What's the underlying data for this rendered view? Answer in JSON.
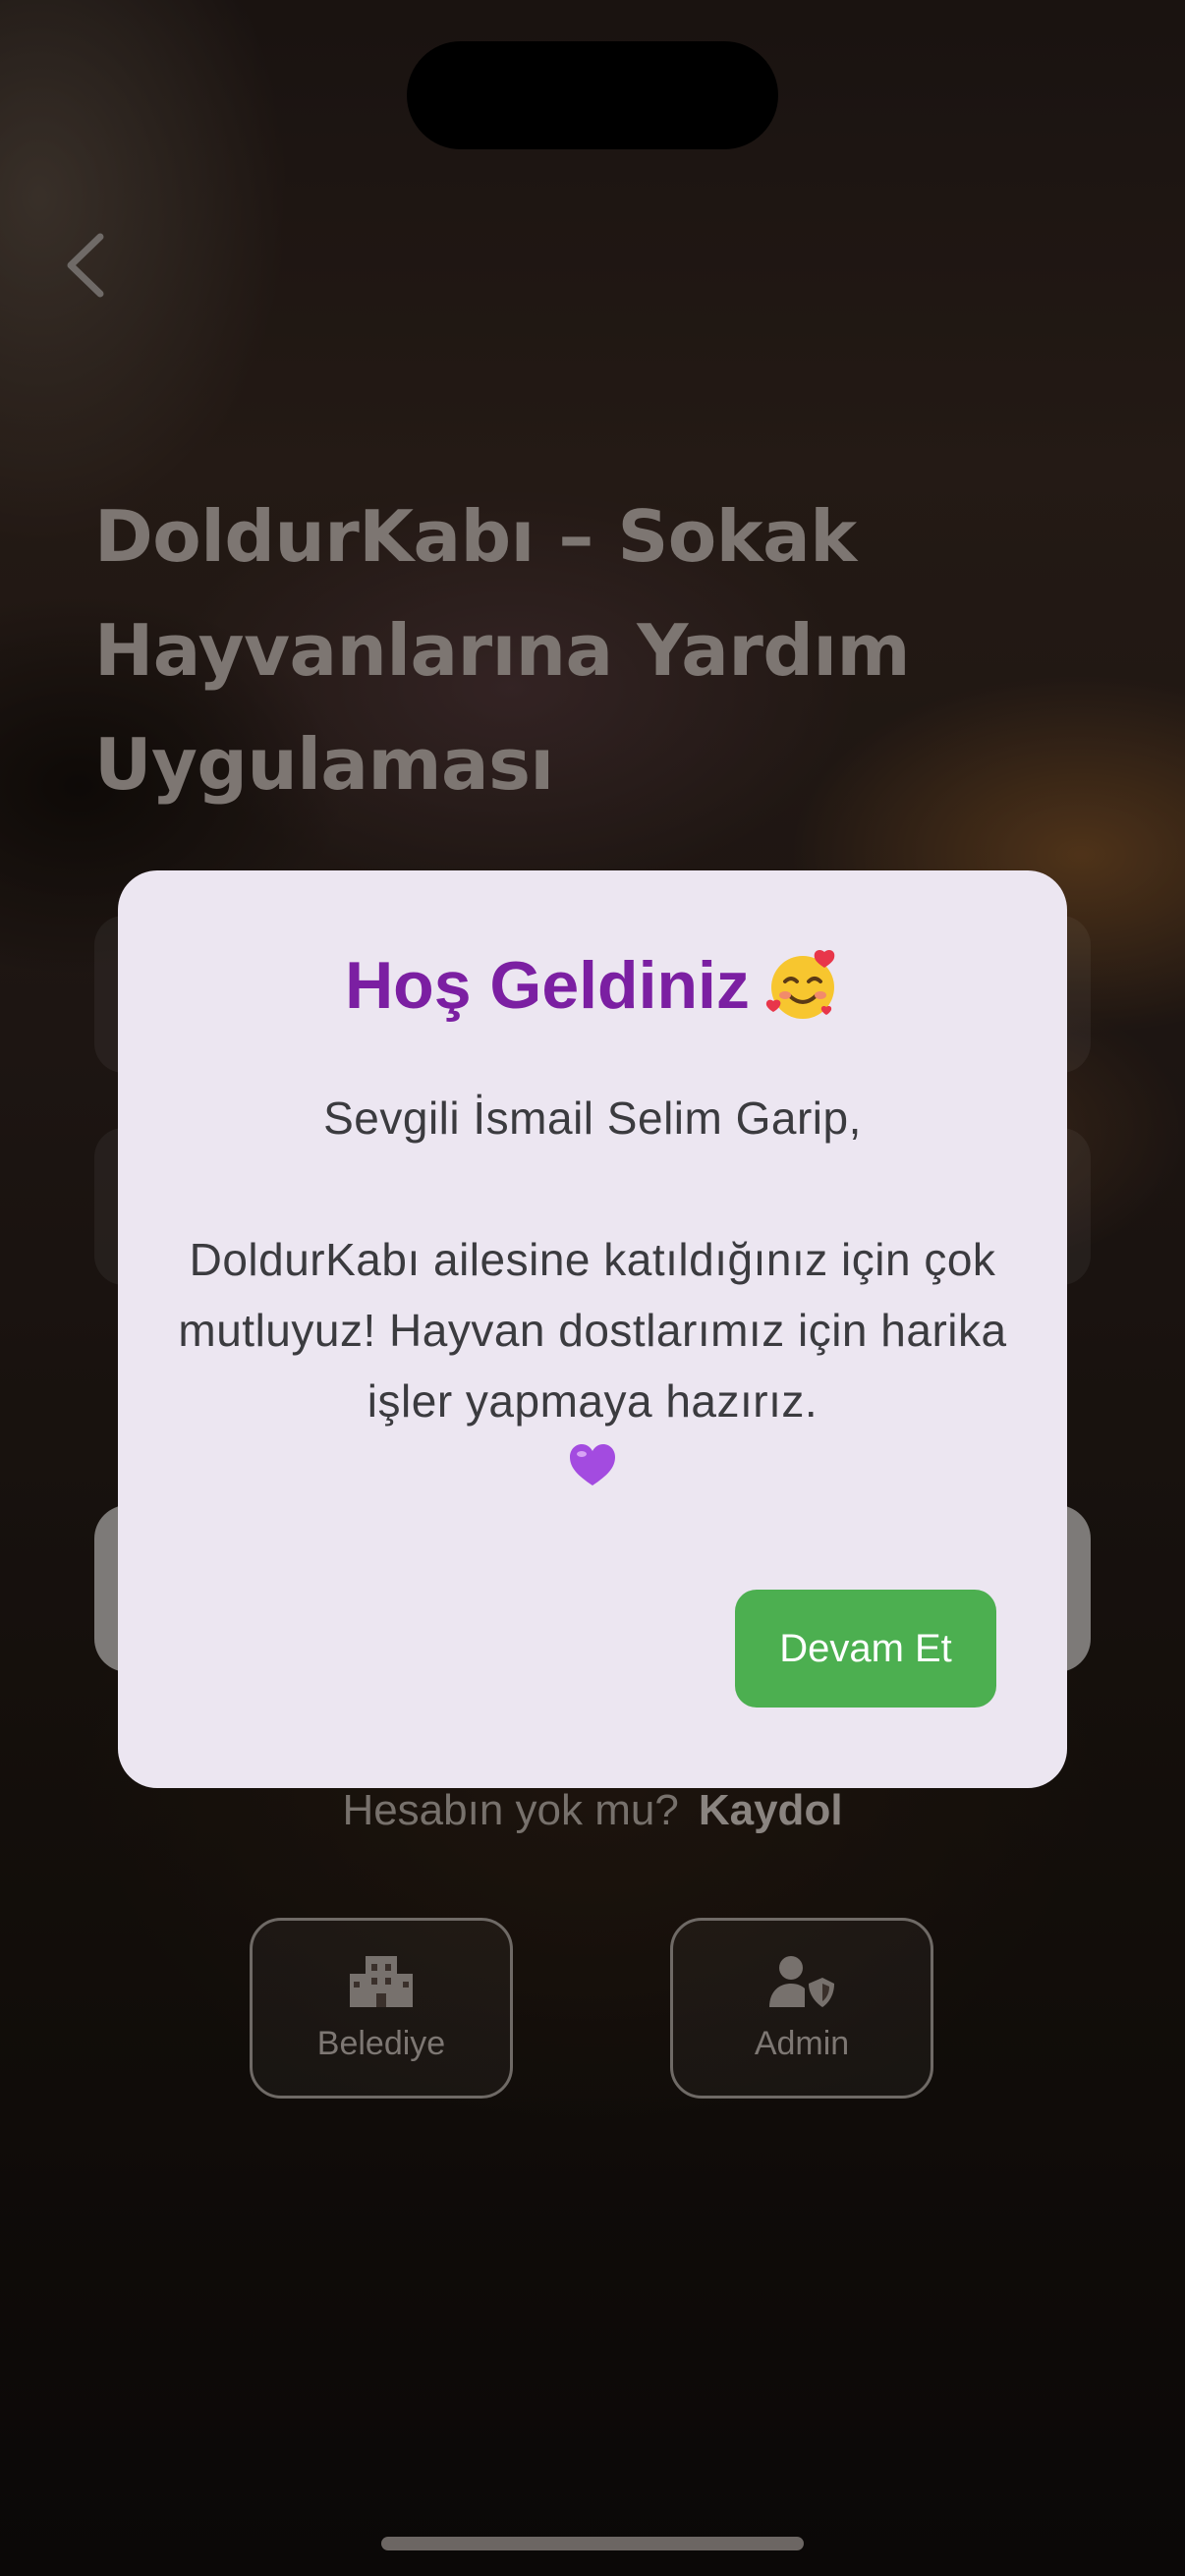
{
  "background": {
    "title": "DoldurKabı – Sokak Hayvanlarına Yardım Uygulaması",
    "signup_prompt": "Hesabın yok mu?",
    "signup_link": "Kaydol",
    "roles": [
      {
        "label": "Belediye",
        "icon": "building-icon"
      },
      {
        "label": "Admin",
        "icon": "user-shield-icon"
      }
    ]
  },
  "dialog": {
    "title": "Hoş Geldiniz",
    "title_emoji": "smiling-face-with-hearts",
    "greeting": "Sevgili İsmail Selim Garip,",
    "message": "DoldurKabı ailesine katıldığınız için çok mutluyuz! Hayvan dostlarımız için harika işler yapmaya hazırız.",
    "message_emoji": "purple-heart",
    "button_label": "Devam Et"
  },
  "colors": {
    "dialog_title": "#7b1fa2",
    "dialog_background": "#ece6f1",
    "button": "#4caf50"
  }
}
